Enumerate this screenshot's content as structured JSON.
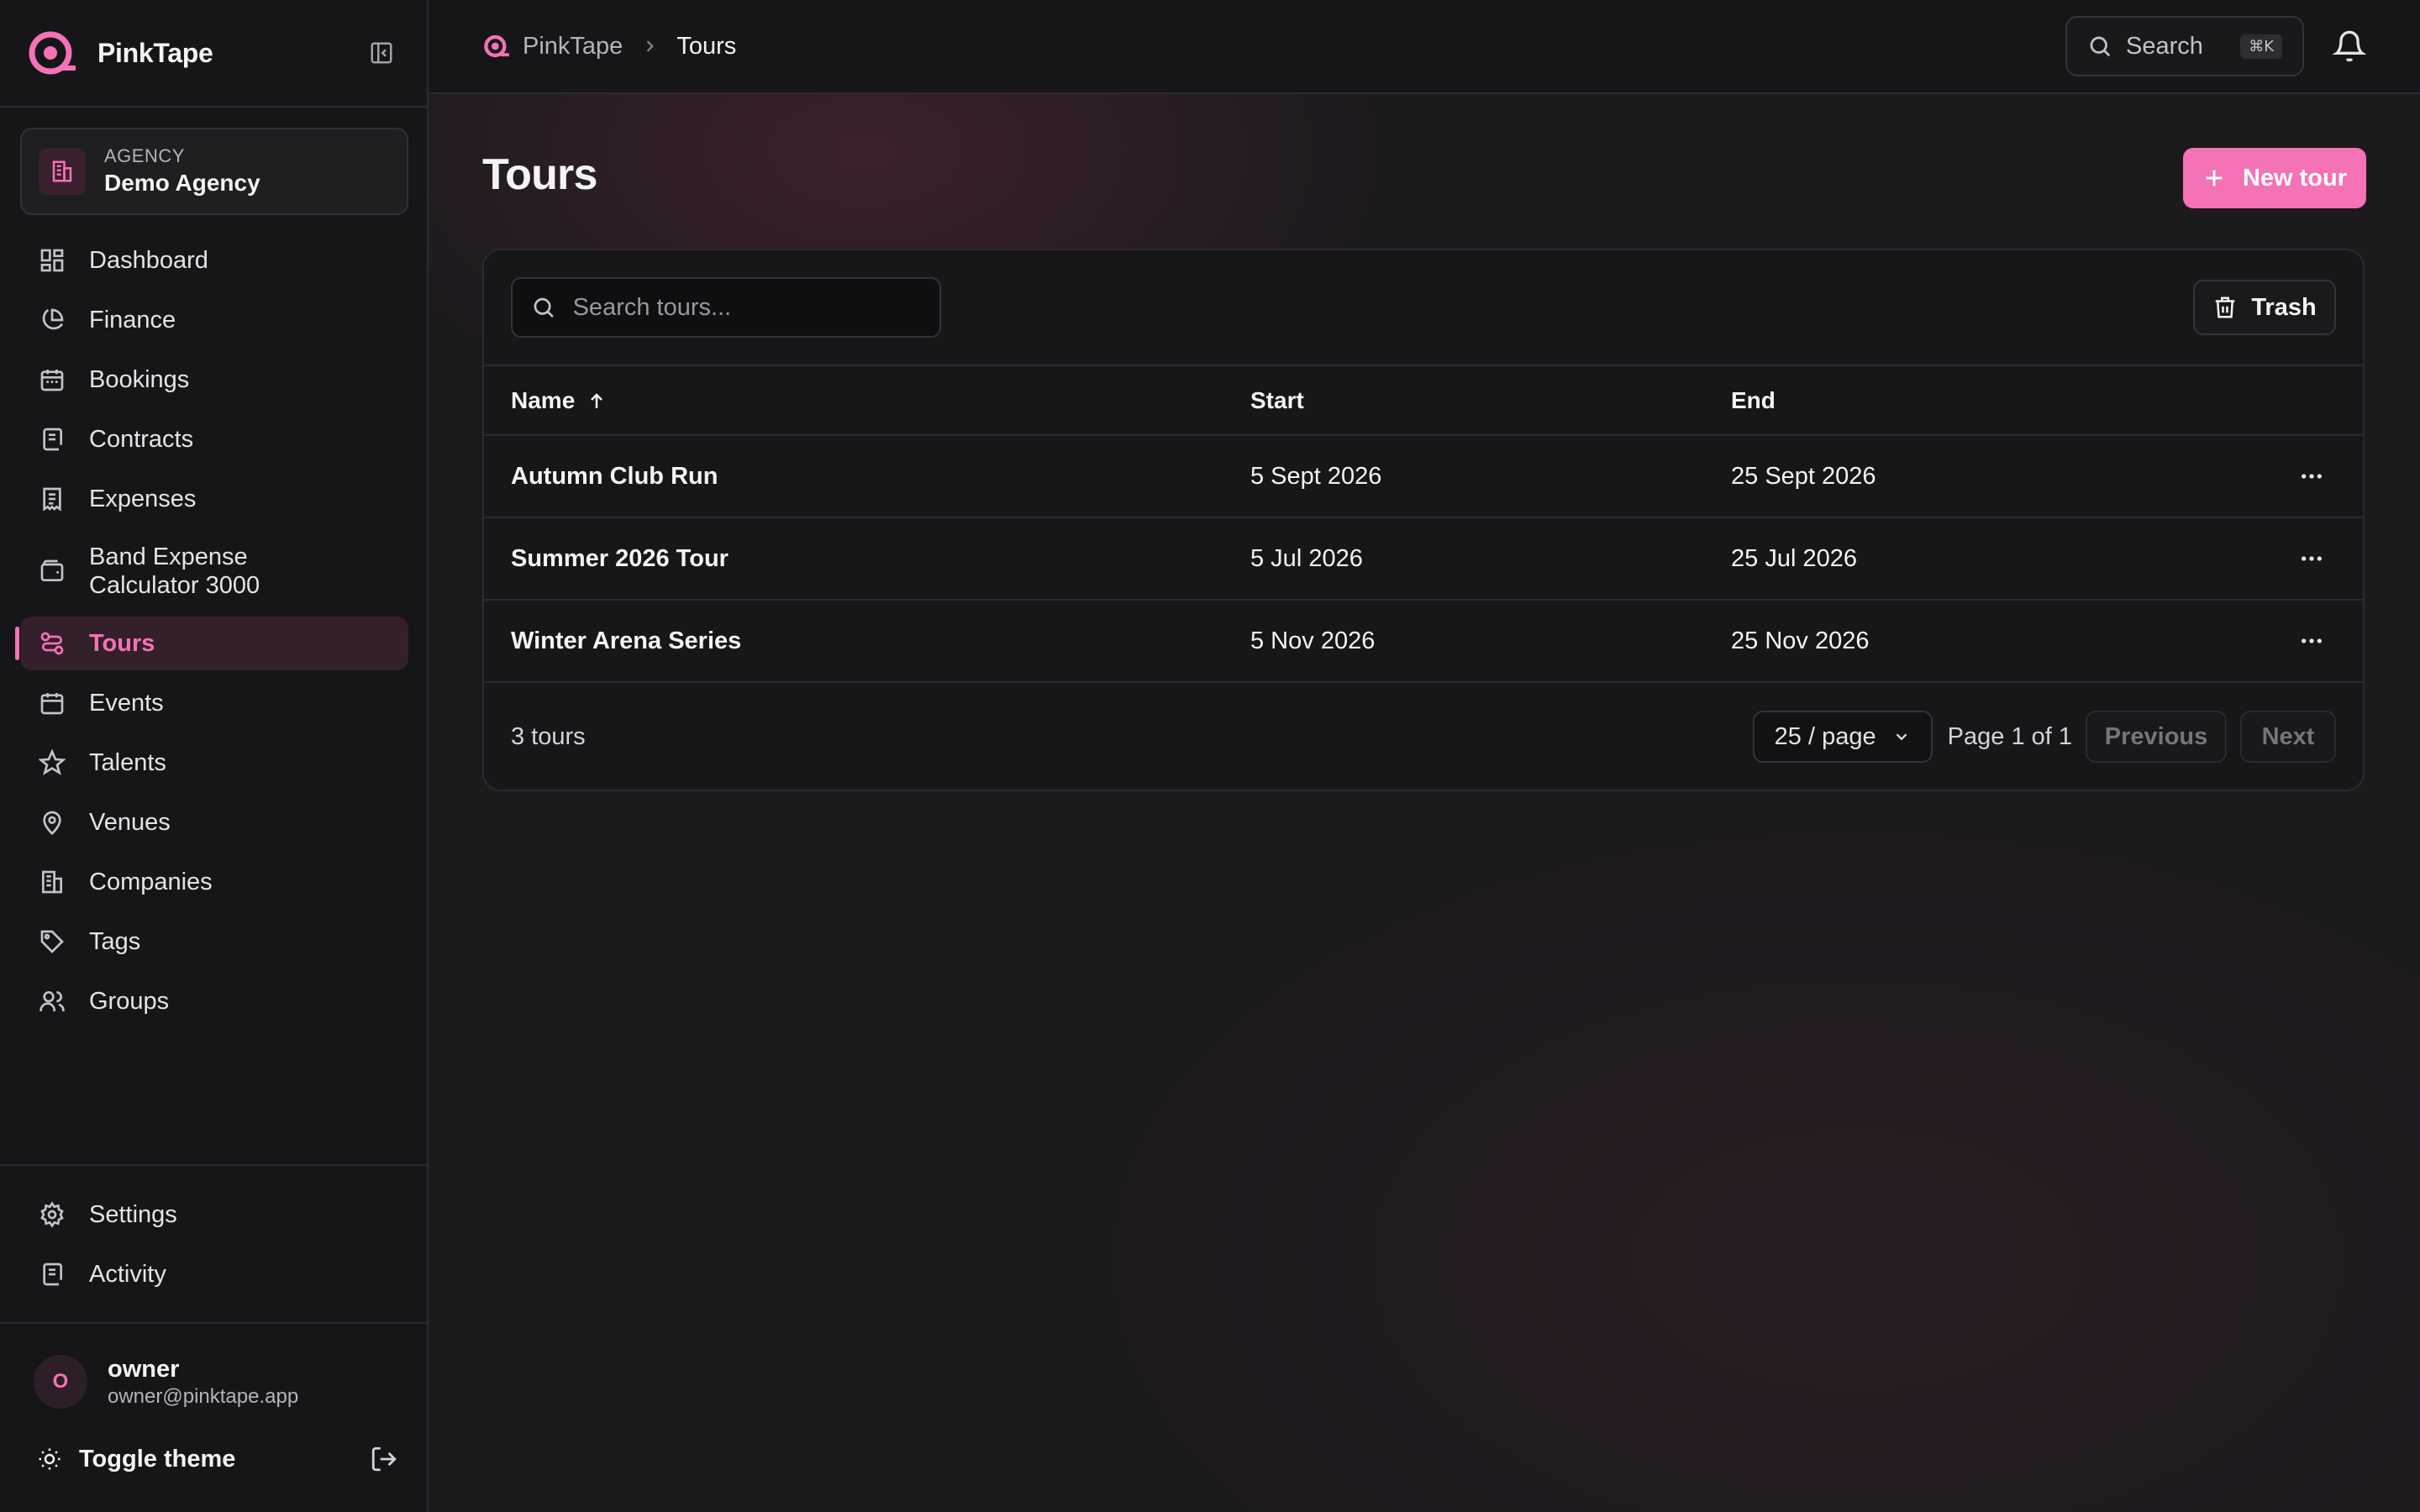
{
  "app": {
    "name": "PinkTape"
  },
  "agency": {
    "kicker": "AGENCY",
    "name": "Demo Agency"
  },
  "sidebar": {
    "items": [
      {
        "label": "Dashboard",
        "icon": "dashboard-icon"
      },
      {
        "label": "Finance",
        "icon": "pie-chart-icon"
      },
      {
        "label": "Bookings",
        "icon": "calendar-icon"
      },
      {
        "label": "Contracts",
        "icon": "scroll-icon"
      },
      {
        "label": "Expenses",
        "icon": "receipt-icon"
      },
      {
        "label": "Band Expense Calculator 3000",
        "icon": "wallet-icon"
      },
      {
        "label": "Tours",
        "icon": "route-icon",
        "active": true
      },
      {
        "label": "Events",
        "icon": "calendar-icon"
      },
      {
        "label": "Talents",
        "icon": "star-icon"
      },
      {
        "label": "Venues",
        "icon": "map-pin-icon"
      },
      {
        "label": "Companies",
        "icon": "building-icon"
      },
      {
        "label": "Tags",
        "icon": "tag-icon"
      },
      {
        "label": "Groups",
        "icon": "users-icon"
      }
    ],
    "bottom_items": [
      {
        "label": "Settings",
        "icon": "gear-icon"
      },
      {
        "label": "Activity",
        "icon": "scroll-icon"
      }
    ],
    "user": {
      "initial": "O",
      "name": "owner",
      "email": "owner@pinktape.app"
    },
    "toggle_theme": "Toggle theme"
  },
  "topbar": {
    "breadcrumb": [
      "PinkTape",
      "Tours"
    ],
    "search_label": "Search",
    "search_shortcut": "⌘K"
  },
  "page": {
    "title": "Tours",
    "new_button": "New tour"
  },
  "table": {
    "search_placeholder": "Search tours...",
    "trash_label": "Trash",
    "columns": {
      "name": "Name",
      "start": "Start",
      "end": "End"
    },
    "rows": [
      {
        "name": "Autumn Club Run",
        "start": "5 Sept 2026",
        "end": "25 Sept 2026"
      },
      {
        "name": "Summer 2026 Tour",
        "start": "5 Jul 2026",
        "end": "25 Jul 2026"
      },
      {
        "name": "Winter Arena Series",
        "start": "5 Nov 2026",
        "end": "25 Nov 2026"
      }
    ],
    "count": "3 tours",
    "per_page": "25 / page",
    "page_info": "Page 1 of 1",
    "prev": "Previous",
    "next": "Next"
  },
  "colors": {
    "accent": "#f472b6",
    "background": "#1c1a1d",
    "sidebar": "#161517"
  }
}
